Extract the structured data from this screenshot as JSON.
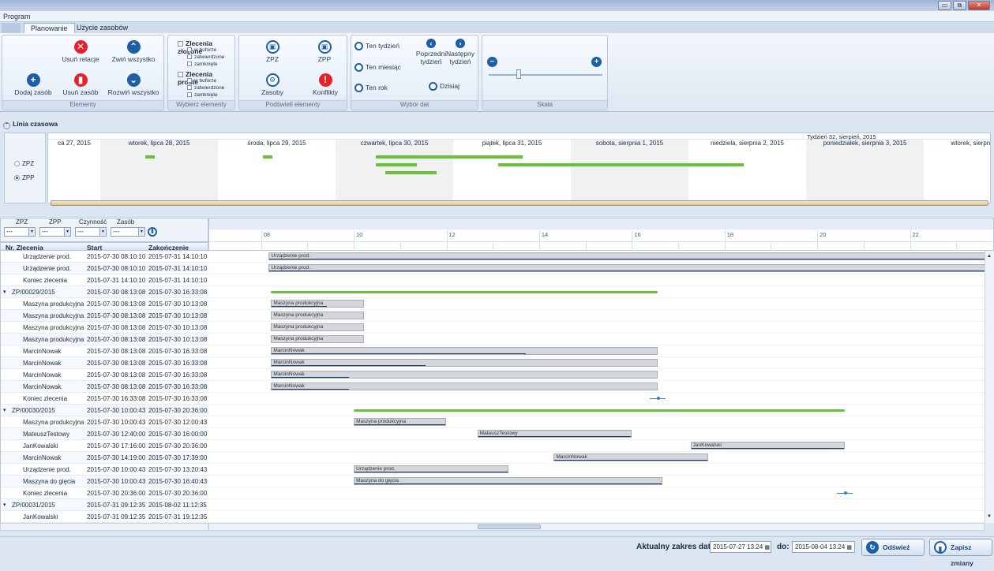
{
  "menu": {
    "program": "Program"
  },
  "tabs": [
    {
      "label": "Planowanie"
    },
    {
      "label": "Użycie zasobów"
    }
  ],
  "ribbon": {
    "elementy": {
      "caption": "Elementy",
      "usun_relacje": "Usuń relacje",
      "zwin_wszystko": "Zwiń wszystko",
      "dodaj_zasob": "Dodaj zasób",
      "usun_zasob": "Usuń zasób",
      "rozwin_wszystko": "Rozwiń wszystko"
    },
    "wybierz": {
      "caption": "Wybierz elementy",
      "zlecenia_zlozone": "Zlecenia złożone",
      "zlecenia_proste": "Zlecenia proste",
      "w_buforze": "w buforze",
      "zatwierdzone": "zatwierdzone",
      "zamkniete": "zamknięte"
    },
    "podswietl": {
      "caption": "Podświetl elementy",
      "zpz": "ZPZ",
      "zpp": "ZPP",
      "zasoby": "Zasoby",
      "konflikty": "Konflikty"
    },
    "daty": {
      "caption": "Wybór dat",
      "ten_tydzien": "Ten tydzień",
      "ten_miesiac": "Ten miesiąc",
      "ten_rok": "Ten rok",
      "poprzedni": "Poprzedni tydzień",
      "nastepny": "Następny tydzień",
      "dzisiaj": "Dzisiaj"
    },
    "skala": {
      "caption": "Skala",
      "level": 0.25
    }
  },
  "timeline": {
    "header": "Linia czasowa",
    "week_label": "Tydzień 32, sierpień, 2015",
    "radios": [
      {
        "label": "ZPZ",
        "checked": false
      },
      {
        "label": "ZPP",
        "checked": true
      }
    ],
    "days": [
      "ca 27, 2015",
      "wtorek, lipca 28, 2015",
      "środa, lipca 29, 2015",
      "czwartek, lipca 30, 2015",
      "piątek, lipca 31, 2015",
      "sobota, sierpnia 1, 2015",
      "niedziela, sierpnia 2, 2015",
      "poniedziałek, sierpnia 3, 2015",
      "wtorek, sierpni"
    ]
  },
  "filters": {
    "labels": [
      "ZPZ",
      "ZPP",
      "Czynność",
      "Zasób"
    ],
    "values": [
      "---",
      "---",
      "---",
      "---"
    ]
  },
  "grid": {
    "columns": [
      "Nr. Zlecenia",
      "Start",
      "Zakończenie"
    ],
    "rows": [
      {
        "name": "Urządzenie prod.",
        "start": "2015-07-30 08:10:10",
        "end": "2015-07-31 14:10:10",
        "group": false
      },
      {
        "name": "Urządzenie prod.",
        "start": "2015-07-30 08:10:10",
        "end": "2015-07-31 14:10:10",
        "group": false
      },
      {
        "name": "Koniec zlecenia",
        "start": "2015-07-31 14:10:10",
        "end": "2015-07-31 14:10:10",
        "group": false
      },
      {
        "name": "ZP/00029/2015",
        "start": "2015-07-30 08:13:08",
        "end": "2015-07-30 16:33:08",
        "group": true
      },
      {
        "name": "Maszyna produkcyjna",
        "start": "2015-07-30 08:13:08",
        "end": "2015-07-30 10:13:08",
        "group": false
      },
      {
        "name": "Maszyna produkcyjna",
        "start": "2015-07-30 08:13:08",
        "end": "2015-07-30 10:13:08",
        "group": false
      },
      {
        "name": "Maszyna produkcyjna",
        "start": "2015-07-30 08:13:08",
        "end": "2015-07-30 10:13:08",
        "group": false
      },
      {
        "name": "Maszyna produkcyjna",
        "start": "2015-07-30 08:13:08",
        "end": "2015-07-30 10:13:08",
        "group": false
      },
      {
        "name": "MarcinNowak",
        "start": "2015-07-30 08:13:08",
        "end": "2015-07-30 16:33:08",
        "group": false
      },
      {
        "name": "MarcinNowak",
        "start": "2015-07-30 08:13:08",
        "end": "2015-07-30 16:33:08",
        "group": false
      },
      {
        "name": "MarcinNowak",
        "start": "2015-07-30 08:13:08",
        "end": "2015-07-30 16:33:08",
        "group": false
      },
      {
        "name": "MarcinNowak",
        "start": "2015-07-30 08:13:08",
        "end": "2015-07-30 16:33:08",
        "group": false
      },
      {
        "name": "Koniec zlecenia",
        "start": "2015-07-30 16:33:08",
        "end": "2015-07-30 16:33:08",
        "group": false
      },
      {
        "name": "ZP/00030/2015",
        "start": "2015-07-30 10:00:43",
        "end": "2015-07-30 20:36:00",
        "group": true
      },
      {
        "name": "Maszyna produkcyjna",
        "start": "2015-07-30 10:00:43",
        "end": "2015-07-30 12:00:43",
        "group": false
      },
      {
        "name": "MateuszTestowy",
        "start": "2015-07-30 12:40:00",
        "end": "2015-07-30 16:00:00",
        "group": false
      },
      {
        "name": "JanKowalski",
        "start": "2015-07-30 17:16:00",
        "end": "2015-07-30 20:36:00",
        "group": false
      },
      {
        "name": "MarcinNowak",
        "start": "2015-07-30 14:19:00",
        "end": "2015-07-30 17:39:00",
        "group": false
      },
      {
        "name": "Urządzenie prod.",
        "start": "2015-07-30 10:00:43",
        "end": "2015-07-30 13:20:43",
        "group": false
      },
      {
        "name": "Maszyna do gięcia",
        "start": "2015-07-30 10:00:43",
        "end": "2015-07-30 16:40:43",
        "group": false
      },
      {
        "name": "Koniec zlecenia",
        "start": "2015-07-30 20:36:00",
        "end": "2015-07-30 20:36:00",
        "group": false
      },
      {
        "name": "ZP/00031/2015",
        "start": "2015-07-31 09:12:35",
        "end": "2015-08-02 11:12:35",
        "group": true
      },
      {
        "name": "JanKowalski",
        "start": "2015-07-31 09:12:35",
        "end": "2015-07-31 19:12:35",
        "group": false
      }
    ]
  },
  "gantt": {
    "hours": [
      "08",
      "10",
      "12",
      "14",
      "16",
      "18",
      "20",
      "22"
    ],
    "bars": [
      {
        "row": 0,
        "label": "Urządzenie prod.",
        "kind": "task",
        "progress": 1.0
      },
      {
        "row": 1,
        "label": "Urządzenie prod.",
        "kind": "task",
        "progress": 1.0
      },
      {
        "row": 2,
        "label": "",
        "kind": "none"
      },
      {
        "row": 3,
        "label": "",
        "kind": "summary"
      },
      {
        "row": 4,
        "label": "Maszyna produkcyjna",
        "kind": "task",
        "progress": 0.6
      },
      {
        "row": 5,
        "label": "Maszyna produkcyjna",
        "kind": "task",
        "progress": 0.0
      },
      {
        "row": 6,
        "label": "Maszyna produkcyjna",
        "kind": "task",
        "progress": 0.0
      },
      {
        "row": 7,
        "label": "Maszyna produkcyjna",
        "kind": "task",
        "progress": 0.0
      },
      {
        "row": 8,
        "label": "MarcinNowak",
        "kind": "task",
        "progress": 0.66
      },
      {
        "row": 9,
        "label": "MarcinNowak",
        "kind": "task",
        "progress": 0.4
      },
      {
        "row": 10,
        "label": "MarcinNowak",
        "kind": "task",
        "progress": 0.2
      },
      {
        "row": 11,
        "label": "MarcinNowak",
        "kind": "task",
        "progress": 0.2
      },
      {
        "row": 12,
        "label": "",
        "kind": "milestone"
      },
      {
        "row": 13,
        "label": "",
        "kind": "summary"
      },
      {
        "row": 14,
        "label": "Maszyna produkcyjna",
        "kind": "task",
        "progress": 1.0
      },
      {
        "row": 15,
        "label": "MateuszTestowy",
        "kind": "task",
        "progress": 1.0
      },
      {
        "row": 16,
        "label": "JanKowalski",
        "kind": "task",
        "progress": 1.0
      },
      {
        "row": 17,
        "label": "MarcinNowak",
        "kind": "task",
        "progress": 1.0
      },
      {
        "row": 18,
        "label": "Urządzenie prod.",
        "kind": "task",
        "progress": 1.0
      },
      {
        "row": 19,
        "label": "Maszyna do gięcia",
        "kind": "task",
        "progress": 1.0
      },
      {
        "row": 20,
        "label": "",
        "kind": "milestone"
      }
    ]
  },
  "status": {
    "range_label": "Aktualny zakres dat:",
    "from": "2015-07-27 13:24",
    "to_label": "do:",
    "to": "2015-08-04 13:24",
    "refresh": "Odśwież",
    "save": "Zapisz zmiany"
  }
}
